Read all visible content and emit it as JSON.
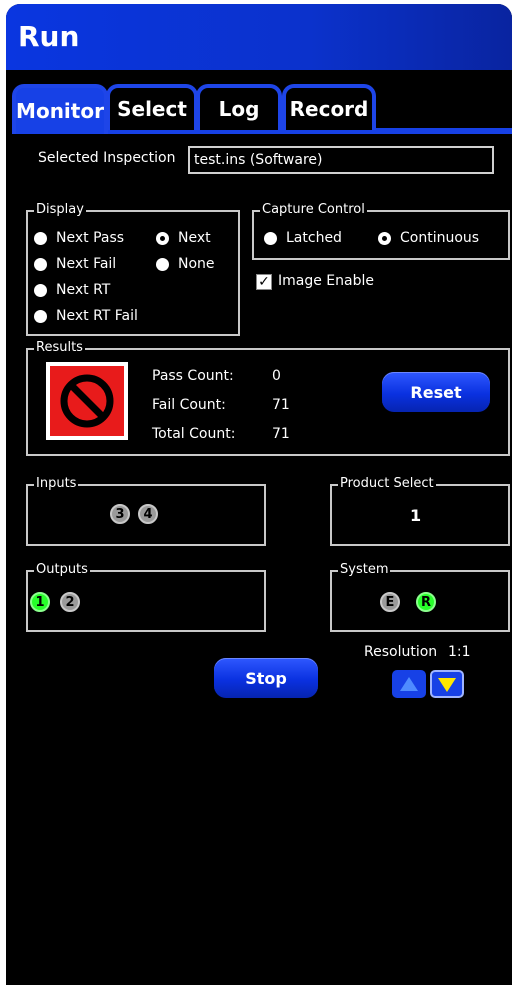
{
  "window": {
    "title": "Run"
  },
  "tabs": [
    {
      "label": "Monitor",
      "active": true
    },
    {
      "label": "Select",
      "active": false
    },
    {
      "label": "Log",
      "active": false
    },
    {
      "label": "Record",
      "active": false
    }
  ],
  "inspection": {
    "label": "Selected Inspection",
    "value": "test.ins (Software)"
  },
  "display": {
    "legend": "Display",
    "options": [
      {
        "label": "Next Pass",
        "selected": false
      },
      {
        "label": "Next Fail",
        "selected": false
      },
      {
        "label": "Next RT",
        "selected": false
      },
      {
        "label": "Next RT Fail",
        "selected": false
      },
      {
        "label": "Next",
        "selected": true
      },
      {
        "label": "None",
        "selected": false
      }
    ]
  },
  "capture": {
    "legend": "Capture Control",
    "options": [
      {
        "label": "Latched",
        "selected": false
      },
      {
        "label": "Continuous",
        "selected": true
      }
    ],
    "image_enable_label": "Image Enable",
    "image_enable_checked": true
  },
  "results": {
    "legend": "Results",
    "pass_label": "Pass Count:",
    "pass_value": "0",
    "fail_label": "Fail Count:",
    "fail_value": "71",
    "total_label": "Total Count:",
    "total_value": "71",
    "reset_label": "Reset"
  },
  "inputs": {
    "legend": "Inputs",
    "items": [
      "3",
      "4"
    ]
  },
  "product_select": {
    "legend": "Product Select",
    "value": "1"
  },
  "outputs": {
    "legend": "Outputs",
    "items": [
      "1",
      "2"
    ]
  },
  "system": {
    "legend": "System",
    "items": [
      "E",
      "R"
    ]
  },
  "resolution": {
    "label": "Resolution",
    "value": "1:1"
  },
  "stop_label": "Stop",
  "colors": {
    "accent": "#1741e6",
    "status_ok": "#27ff2a",
    "fail_red": "#e81b1b",
    "arrow_yellow": "#ffe600"
  }
}
